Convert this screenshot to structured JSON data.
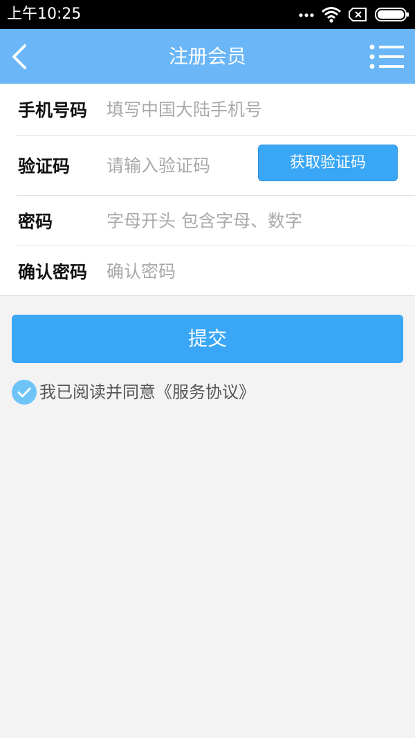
{
  "status_bar": {
    "time": "上午10:25",
    "icons": [
      "more-dots-icon",
      "wifi-icon",
      "no-sim-icon",
      "battery-icon"
    ]
  },
  "nav": {
    "title": "注册会员",
    "back_icon": "back-arrow-icon",
    "menu_icon": "list-menu-icon",
    "background": "#6ab6f7"
  },
  "form": {
    "phone": {
      "label": "手机号码",
      "placeholder": "填写中国大陆手机号",
      "value": ""
    },
    "code": {
      "label": "验证码",
      "placeholder": "请输入验证码",
      "value": "",
      "button_label": "获取验证码"
    },
    "password": {
      "label": "密码",
      "placeholder": "字母开头 包含字母、数字",
      "value": ""
    },
    "confirm": {
      "label": "确认密码",
      "placeholder": "确认密码",
      "value": ""
    }
  },
  "submit_label": "提交",
  "agreement": {
    "checked": true,
    "text": "我已阅读并同意《服务协议》"
  },
  "colors": {
    "accent": "#3aa7f6",
    "check": "#6ec4f7"
  }
}
